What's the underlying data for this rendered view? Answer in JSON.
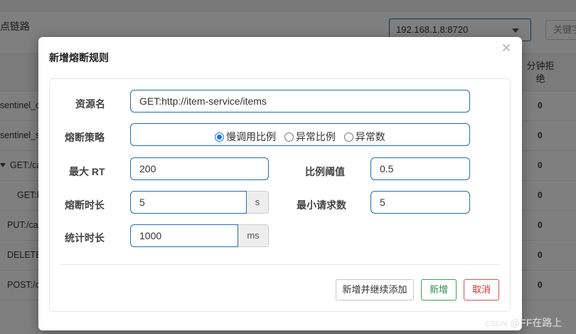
{
  "background": {
    "title_fragment": "点链路",
    "machine_select": "192.168.1.8:8720",
    "search_placeholder": "关键字",
    "col_header": "分钟拒\n绝",
    "rows": [
      {
        "name": "sentinel_de",
        "value": "0"
      },
      {
        "name": "sentinel_sp",
        "value": "0"
      },
      {
        "name": "GET:/ca",
        "value": "0"
      },
      {
        "name": "GET:h",
        "value": "0"
      },
      {
        "name": "PUT:/car",
        "value": "0"
      },
      {
        "name": "DELETE",
        "value": "0"
      },
      {
        "name": "POST:/c",
        "value": "0"
      }
    ]
  },
  "modal": {
    "title": "新增熔断规则",
    "close_symbol": "×",
    "fields": {
      "resource_label": "资源名",
      "resource_value": "GET:http://item-service/items",
      "strategy_label": "熔断策略",
      "strategy_options": [
        "慢调用比例",
        "异常比例",
        "异常数"
      ],
      "strategy_selected": 0,
      "max_rt_label": "最大 RT",
      "max_rt_value": "200",
      "ratio_label": "比例阈值",
      "ratio_value": "0.5",
      "duration_label": "熔断时长",
      "duration_value": "5",
      "duration_unit": "s",
      "min_requests_label": "最小请求数",
      "min_requests_value": "5",
      "stat_label": "统计时长",
      "stat_value": "1000",
      "stat_unit": "ms"
    },
    "buttons": {
      "add_continue": "新增并继续添加",
      "add": "新增",
      "cancel": "取消"
    }
  },
  "watermark": {
    "prefix": "CSDN",
    "author": "@FF在路上"
  },
  "colors": {
    "input_border": "#1f6fb5",
    "radio_checked": "#1a73e8",
    "add_button": "#3c9e5b",
    "cancel_button": "#d9534f"
  }
}
